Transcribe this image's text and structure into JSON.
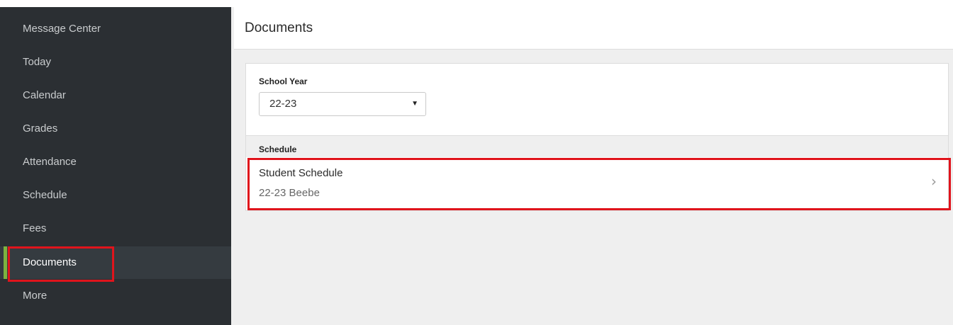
{
  "sidebar": {
    "items": [
      {
        "label": "Message Center"
      },
      {
        "label": "Today"
      },
      {
        "label": "Calendar"
      },
      {
        "label": "Grades"
      },
      {
        "label": "Attendance"
      },
      {
        "label": "Schedule"
      },
      {
        "label": "Fees"
      },
      {
        "label": "Documents",
        "active": true
      },
      {
        "label": "More"
      }
    ]
  },
  "main": {
    "title": "Documents",
    "school_year": {
      "label": "School Year",
      "value": "22-23"
    },
    "section": {
      "label": "Schedule",
      "documents": [
        {
          "title": "Student Schedule",
          "subtitle": "22-23 Beebe"
        }
      ]
    }
  },
  "colors": {
    "sidebar_bg": "#2b2f33",
    "active_accent": "#7db33f",
    "highlight": "#e0141c"
  }
}
